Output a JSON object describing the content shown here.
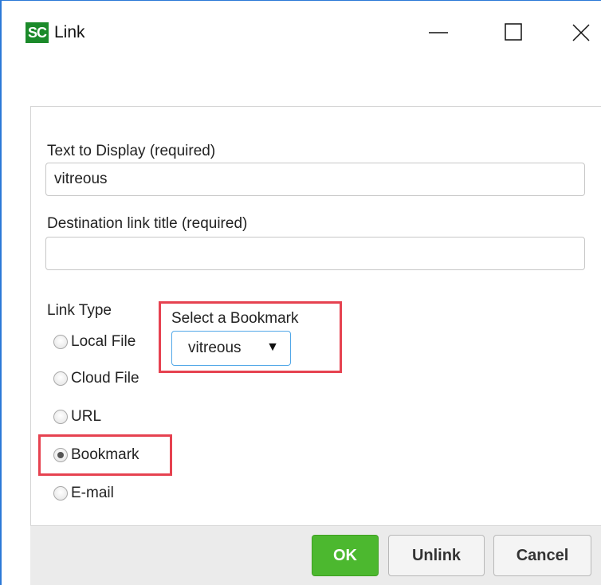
{
  "window": {
    "logo_text": "SC",
    "title": "Link",
    "controls": {
      "minimize": "minimize-icon",
      "maximize": "maximize-icon",
      "close": "close-icon"
    }
  },
  "form": {
    "text_to_display_label": "Text to Display (required)",
    "text_to_display_value": "vitreous",
    "destination_label": "Destination link title (required)",
    "destination_value": "",
    "link_type_label": "Link Type",
    "link_types": [
      {
        "label": "Local File",
        "checked": false
      },
      {
        "label": "Cloud File",
        "checked": false
      },
      {
        "label": "URL",
        "checked": false
      },
      {
        "label": "Bookmark",
        "checked": true
      },
      {
        "label": "E-mail",
        "checked": false
      }
    ],
    "bookmark_label": "Select a Bookmark",
    "bookmark_value": "vitreous"
  },
  "buttons": {
    "ok": "OK",
    "unlink": "Unlink",
    "cancel": "Cancel"
  },
  "colors": {
    "ok": "#4cb82f",
    "highlight": "#e64250",
    "accent": "#2b79d7"
  }
}
